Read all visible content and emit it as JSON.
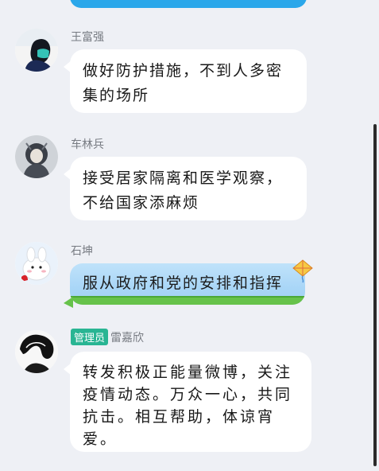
{
  "messages": [
    {
      "sender": "王富强",
      "text": "做好防护措施，不到人多密集的场所"
    },
    {
      "sender": "车林兵",
      "text": "接受居家隔离和医学观察，不给国家添麻烦"
    },
    {
      "sender": "石坤",
      "text": "服从政府和党的安排和指挥"
    },
    {
      "badge": "管理员",
      "sender": "雷嘉欣",
      "text": "转发积极正能量微博，关注疫情动态。万众一心，共同抗击。相互帮助，体谅宵爱。"
    }
  ],
  "colors": {
    "background": "#eef0f5",
    "admin_badge": "#29b593",
    "top_bubble": "#2aa7ea",
    "scrollbar": "#2b2b2b"
  }
}
